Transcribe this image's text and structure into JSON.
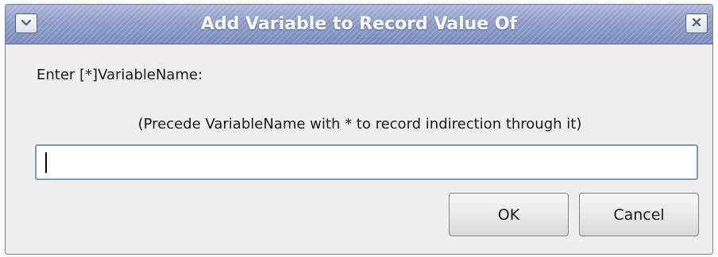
{
  "dialog": {
    "title": "Add Variable to Record Value Of",
    "menu_icon": "chevron-down-icon",
    "close_icon": "close-icon",
    "prompt_label": "Enter [*]VariableName:",
    "hint_label": "(Precede VariableName with * to record indirection through it)",
    "input_value": "",
    "ok_label": "OK",
    "cancel_label": "Cancel"
  },
  "colors": {
    "titlebar": "#8c9bc5",
    "input_border": "#7d96c4",
    "window_bg": "#efefef"
  }
}
